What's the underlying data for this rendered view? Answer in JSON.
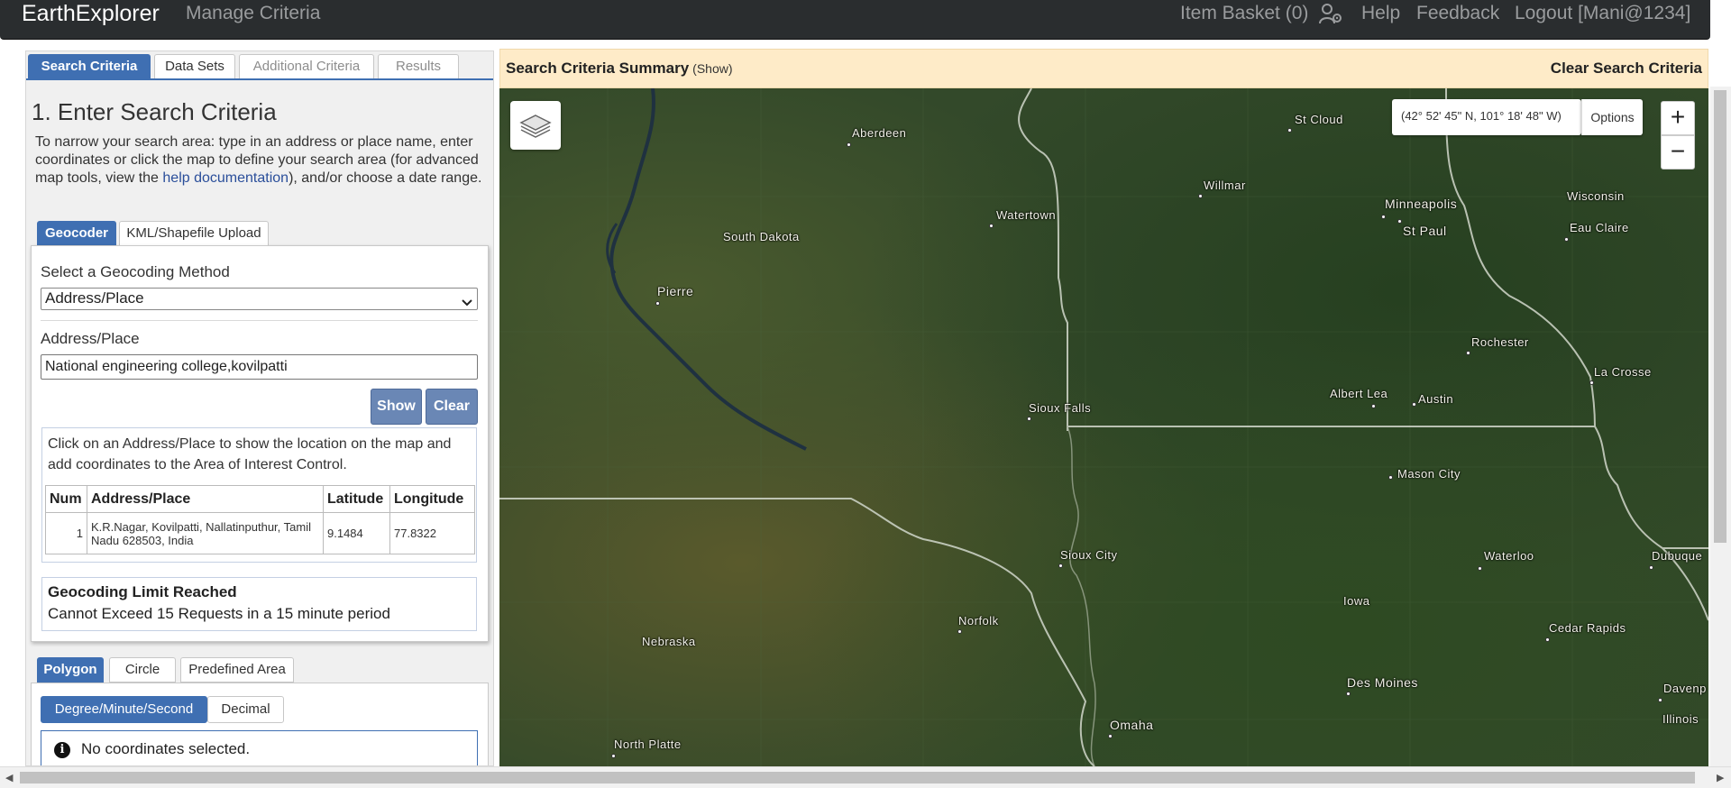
{
  "nav": {
    "brand": "EarthExplorer",
    "manage": "Manage Criteria",
    "basket": "Item Basket (0)",
    "help": "Help",
    "feedback": "Feedback",
    "logout": "Logout [Mani@1234]"
  },
  "tabs": [
    {
      "label": "Search Criteria",
      "active": true
    },
    {
      "label": "Data Sets",
      "active": false
    },
    {
      "label": "Additional Criteria",
      "active": false
    },
    {
      "label": "Results",
      "active": false
    }
  ],
  "search": {
    "heading": "1. Enter Search Criteria",
    "intro_before": "To narrow your search area: type in an address or place name, enter coordinates or click the map to define your search area (for advanced map tools, view the ",
    "intro_link": "help documentation",
    "intro_after": "), and/or choose a date range."
  },
  "subtabs": [
    "Geocoder",
    "KML/Shapefile Upload"
  ],
  "geocoder": {
    "method_label": "Select a Geocoding Method",
    "method_value": "Address/Place",
    "address_label": "Address/Place",
    "address_value": "National engineering college,kovilpatti",
    "show_label": "Show",
    "clear_label": "Clear",
    "results_note": "Click on an Address/Place to show the location on the map and add coordinates to the Area of Interest Control.",
    "columns": [
      "Num",
      "Address/Place",
      "Latitude",
      "Longitude"
    ],
    "rows": [
      {
        "num": "1",
        "address": "K.R.Nagar, Kovilpatti, Nallatinputhur, Tamil Nadu 628503, India",
        "lat": "9.1484",
        "lon": "77.8322"
      }
    ],
    "limit_title": "Geocoding Limit Reached",
    "limit_msg": "Cannot Exceed 15 Requests in a 15 minute period"
  },
  "area_tabs": [
    "Polygon",
    "Circle",
    "Predefined Area"
  ],
  "coord_format": [
    "Degree/Minute/Second",
    "Decimal"
  ],
  "no_coords": "No coordinates selected.",
  "summary": {
    "title": "Search Criteria Summary",
    "show": "(Show)",
    "clear": "Clear Search Criteria"
  },
  "map": {
    "coord_readout": "(42° 52' 45\" N, 101° 18' 48\" W)",
    "options": "Options",
    "zoom_in": "+",
    "zoom_out": "−",
    "places": [
      "Aberdeen",
      "St Cloud",
      "Willmar",
      "Watertown",
      "Minneapolis",
      "St Paul",
      "Wisconsin",
      "Eau Claire",
      "South Dakota",
      "Pierre",
      "Rochester",
      "La Crosse",
      "Albert Lea",
      "Austin",
      "Sioux Falls",
      "Mason City",
      "Sioux City",
      "Waterloo",
      "Dubuque",
      "Iowa",
      "Norfolk",
      "Cedar Rapids",
      "Nebraska",
      "Des Moines",
      "Davenp",
      "Omaha",
      "Illinois",
      "North Platte"
    ]
  },
  "colors": {
    "accent": "#3f6fb2",
    "nav_bg": "#2a2d2f",
    "summary_bg": "#feebc8",
    "button": "#6a87b5",
    "map_land": "#2f4a25"
  },
  "icons": {
    "user_settings": "user-gear-icon",
    "layers": "layers-icon",
    "info": "info-icon",
    "dropdown": "chevron-down-icon"
  }
}
